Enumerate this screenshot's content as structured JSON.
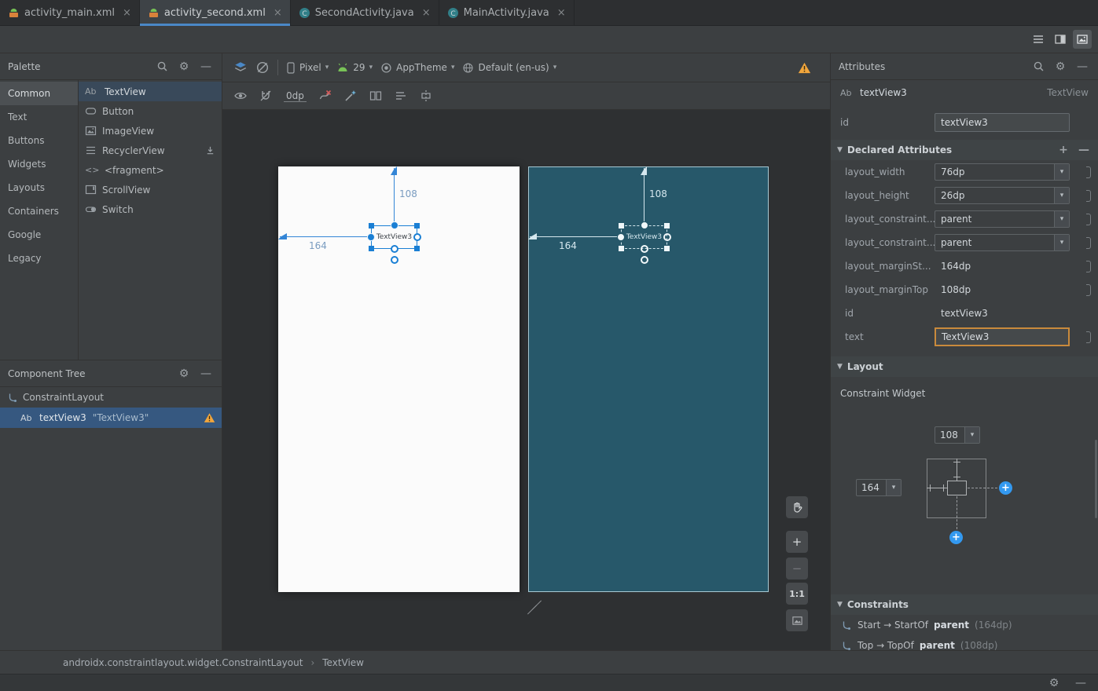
{
  "tabs": [
    {
      "label": "activity_main.xml"
    },
    {
      "label": "activity_second.xml"
    },
    {
      "label": "SecondActivity.java"
    },
    {
      "label": "MainActivity.java"
    }
  ],
  "palette": {
    "title": "Palette",
    "categories": [
      {
        "label": "Common"
      },
      {
        "label": "Text"
      },
      {
        "label": "Buttons"
      },
      {
        "label": "Widgets"
      },
      {
        "label": "Layouts"
      },
      {
        "label": "Containers"
      },
      {
        "label": "Google"
      },
      {
        "label": "Legacy"
      }
    ],
    "items": [
      {
        "label": "TextView"
      },
      {
        "label": "Button"
      },
      {
        "label": "ImageView"
      },
      {
        "label": "RecyclerView"
      },
      {
        "label": "<fragment>"
      },
      {
        "label": "ScrollView"
      },
      {
        "label": "Switch"
      }
    ]
  },
  "tree": {
    "title": "Component Tree",
    "items": [
      {
        "label": "ConstraintLayout"
      },
      {
        "label": "textView3",
        "detail": "\"TextView3\""
      }
    ]
  },
  "designbar": {
    "device": "Pixel",
    "api": "29",
    "theme": "AppTheme",
    "locale": "Default (en-us)",
    "default_margin": "0dp"
  },
  "canvas": {
    "widget_text": "TextView3",
    "margin_top": "108",
    "margin_start": "164",
    "zoom": "1:1"
  },
  "attributes": {
    "title": "Attributes",
    "component_name": "textView3",
    "component_type": "TextView",
    "id_label": "id",
    "id_value": "textView3",
    "declared": {
      "title": "Declared Attributes",
      "rows": [
        {
          "key": "layout_width",
          "value": "76dp"
        },
        {
          "key": "layout_height",
          "value": "26dp"
        },
        {
          "key": "layout_constraint...",
          "value": "parent"
        },
        {
          "key": "layout_constraint...",
          "value": "parent"
        },
        {
          "key": "layout_marginSt...",
          "value": "164dp"
        },
        {
          "key": "layout_marginTop",
          "value": "108dp"
        },
        {
          "key": "id",
          "value": "textView3"
        },
        {
          "key": "text",
          "value": "TextView3"
        }
      ]
    },
    "layout": {
      "title": "Layout",
      "widget_label": "Constraint Widget",
      "top_margin": "108",
      "start_margin": "164"
    },
    "constraints": {
      "title": "Constraints",
      "items": [
        {
          "prefix": "Start → StartOf",
          "target": "parent",
          "margin": "(164dp)"
        },
        {
          "prefix": "Top → TopOf",
          "target": "parent",
          "margin": "(108dp)"
        }
      ]
    }
  },
  "icons": {
    "textview_glyph": "Ab",
    "fragment_glyph": "<>"
  },
  "status": {
    "path": "androidx.constraintlayout.widget.ConstraintLayout",
    "separator": "›",
    "element": "TextView"
  }
}
